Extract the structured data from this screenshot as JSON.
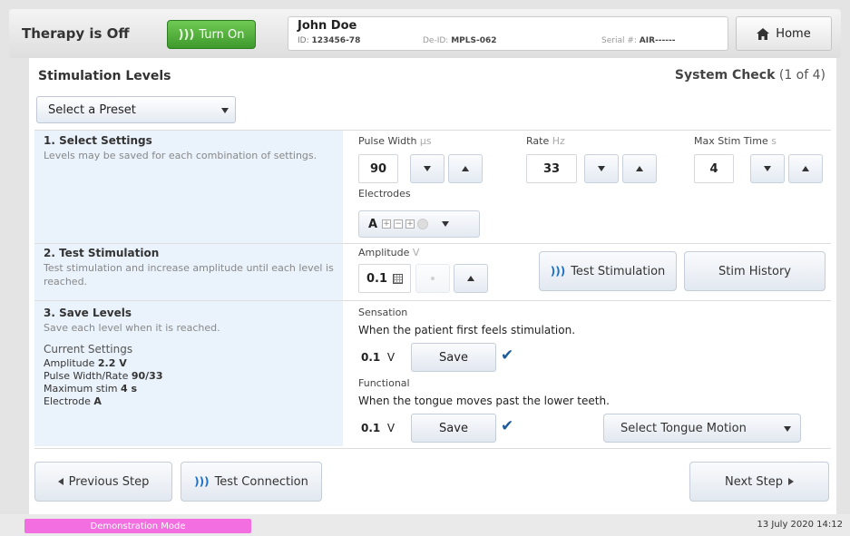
{
  "header": {
    "therapy_status": "Therapy is Off",
    "turn_on_label": "Turn On",
    "patient_name": "John Doe",
    "id_label": "ID:",
    "id_value": "123456-78",
    "deid_label": "De-ID:",
    "deid_value": "MPLS-062",
    "serial_label": "Serial #:",
    "serial_value": "AIR------",
    "home_label": "Home"
  },
  "page": {
    "title": "Stimulation Levels",
    "step_label": "System Check",
    "step_count": "(1 of 4)",
    "preset_placeholder": "Select a Preset"
  },
  "section1": {
    "title": "1. Select Settings",
    "desc": "Levels may be saved for each combination of settings.",
    "pulse_width_label": "Pulse Width",
    "pulse_width_unit": "µs",
    "pulse_width_value": "90",
    "rate_label": "Rate",
    "rate_unit": "Hz",
    "rate_value": "33",
    "max_stim_label": "Max Stim Time",
    "max_stim_unit": "s",
    "max_stim_value": "4",
    "electrodes_label": "Electrodes",
    "electrode_value": "A"
  },
  "section2": {
    "title": "2. Test Stimulation",
    "desc": "Test stimulation and increase amplitude until each level is reached.",
    "amplitude_label": "Amplitude",
    "amplitude_unit": "V",
    "amplitude_value": "0.1",
    "test_stim_label": "Test Stimulation",
    "stim_history_label": "Stim History"
  },
  "section3": {
    "title": "3. Save Levels",
    "desc": "Save each level when it is reached.",
    "current_settings_title": "Current Settings",
    "amp_label": "Amplitude",
    "amp_value": "2.2 V",
    "pwr_label": "Pulse Width/Rate",
    "pwr_value": "90/33",
    "max_label": "Maximum stim",
    "max_value": "4 s",
    "electrode_label": "Electrode",
    "electrode_value": "A",
    "sensation_label": "Sensation",
    "sensation_desc": "When the patient first feels stimulation.",
    "sensation_value": "0.1",
    "sensation_unit": "V",
    "functional_label": "Functional",
    "functional_desc": "When the tongue moves past the lower teeth.",
    "functional_value": "0.1",
    "functional_unit": "V",
    "save_label": "Save",
    "tongue_motion_placeholder": "Select Tongue Motion"
  },
  "nav": {
    "prev_label": "Previous Step",
    "test_connection_label": "Test Connection",
    "next_label": "Next Step"
  },
  "footer": {
    "demo_label": "Demonstration Mode",
    "datetime": "13 July 2020 14:12"
  },
  "colors": {
    "turn_on_green": "#4caf3a",
    "demo_pink": "#f36ee0",
    "check_blue": "#1d5b9a",
    "section_bg": "#eaf2fb"
  },
  "icons": [
    "stim-icon",
    "home-icon",
    "dropdown-icon",
    "up-icon",
    "down-icon",
    "grid-icon",
    "check-icon",
    "left-arrow-icon",
    "right-arrow-icon"
  ]
}
